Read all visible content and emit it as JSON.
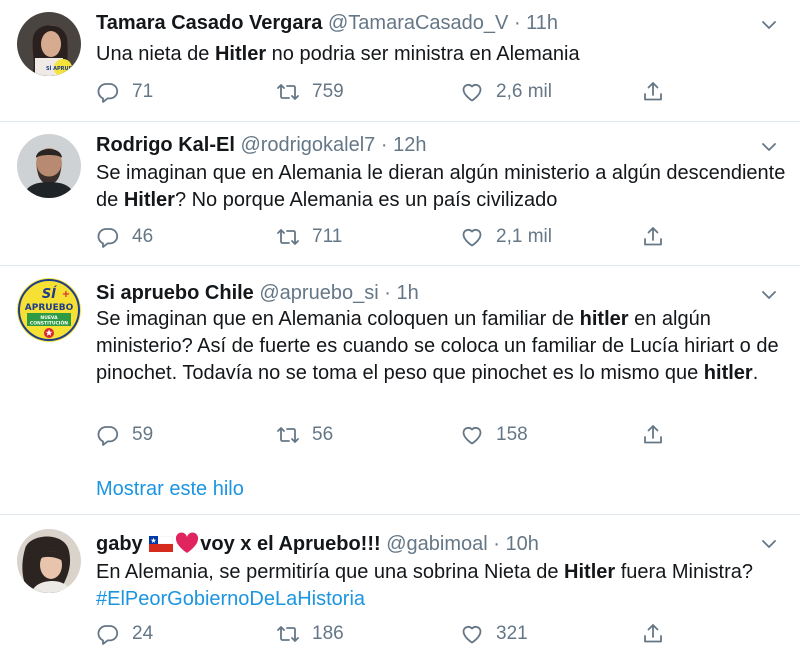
{
  "tweets": [
    {
      "name": "Tamara Casado Vergara",
      "handle": "@TamaraCasado_V",
      "sep": "·",
      "time": "11h",
      "text_parts": [
        "Una nieta de ",
        "Hitler",
        " no podria ser ministra en Alemania"
      ],
      "replies": "71",
      "retweets": "759",
      "likes": "2,6 mil",
      "avatar_badge": "SÍ APRUEBO"
    },
    {
      "name": "Rodrigo Kal-El",
      "handle": "@rodrigokalel7",
      "sep": "·",
      "time": "12h",
      "text_parts": [
        "Se imaginan que en Alemania le dieran algún ministerio a algún descendiente de ",
        "Hitler",
        "? No porque Alemania es un país civilizado"
      ],
      "replies": "46",
      "retweets": "711",
      "likes": "2,1 mil"
    },
    {
      "name": "Si apruebo Chile",
      "handle": "@apruebo_si",
      "sep": "·",
      "time": "1h",
      "text_parts": [
        "Se imaginan que en Alemania coloquen un familiar de ",
        "hitler",
        " en algún ministerio? Así de fuerte es cuando se coloca un familiar de Lucía hiriart o de pinochet. Todavía no se toma el peso que pinochet es lo mismo que ",
        "hitler",
        "."
      ],
      "replies": "59",
      "retweets": "56",
      "likes": "158",
      "show_thread": "Mostrar este hilo",
      "avatar_text": {
        "si": "SÍ",
        "apruebo": "APRUEBO",
        "nueva": "NUEVA",
        "constitucion": "CONSTITUCIÓN"
      }
    },
    {
      "name_parts": [
        "gaby ",
        "voy x el Apruebo!!!"
      ],
      "handle": "@gabimoal",
      "sep": "·",
      "time": "10h",
      "text_parts": [
        "En Alemania, se permitiría que una sobrina Nieta de ",
        "Hitler",
        " fuera Ministra?"
      ],
      "hashtag": "#ElPeorGobiernoDeLaHistoria",
      "replies": "24",
      "retweets": "186",
      "likes": "321"
    }
  ],
  "colors": {
    "text": "#14171a",
    "secondary": "#657786",
    "link": "#1b95e0",
    "divider": "#e1e8ed"
  },
  "icons": [
    "reply-icon",
    "retweet-icon",
    "like-icon",
    "share-icon",
    "chevron-down-icon",
    "chile-flag-icon",
    "red-heart-icon"
  ]
}
